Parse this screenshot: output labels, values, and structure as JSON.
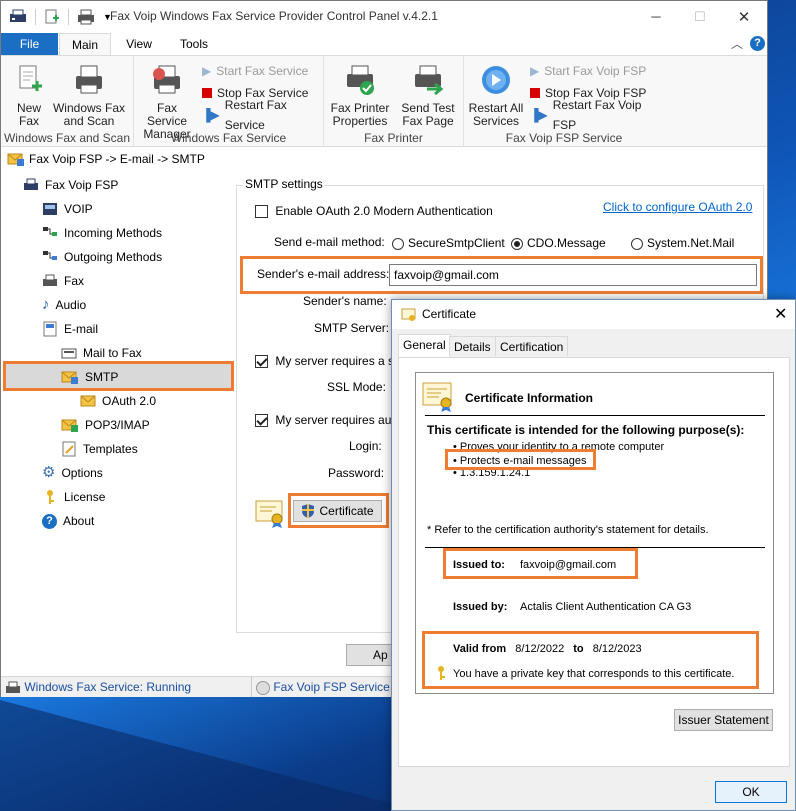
{
  "window": {
    "title": "Fax Voip Windows Fax Service Provider Control Panel v.4.2.1",
    "minimize": "─",
    "maximize": "☐",
    "close": "✕"
  },
  "ribbon_tabs": [
    "File",
    "Main",
    "View",
    "Tools"
  ],
  "ribbon_groups": {
    "g1": {
      "label": "Windows Fax and Scan",
      "new_fax": "New Fax",
      "wfs": "Windows Fax and Scan"
    },
    "g2": {
      "label": "Windows Fax Service",
      "manager": "Fax Service Manager",
      "start": "Start Fax Service",
      "stop": "Stop Fax Service",
      "restart": "Restart Fax Service"
    },
    "g3": {
      "label": "Fax Printer",
      "props": "Fax Printer Properties",
      "test": "Send Test Fax Page"
    },
    "g4": {
      "label": "Fax Voip FSP Service",
      "restart_all": "Restart All Services",
      "start": "Start Fax Voip FSP",
      "stop": "Stop Fax Voip FSP",
      "restart": "Restart Fax Voip FSP"
    }
  },
  "breadcrumb": "Fax Voip FSP -> E-mail -> SMTP",
  "tree": {
    "root": "Fax Voip FSP",
    "voip": "VOIP",
    "incoming": "Incoming Methods",
    "outgoing": "Outgoing Methods",
    "fax": "Fax",
    "audio": "Audio",
    "email": "E-mail",
    "mailtofax": "Mail to Fax",
    "smtp": "SMTP",
    "oauth": "OAuth 2.0",
    "pop3": "POP3/IMAP",
    "templates": "Templates",
    "options": "Options",
    "license": "License",
    "about": "About"
  },
  "smtp": {
    "group": "SMTP settings",
    "oauth_check": "Enable OAuth 2.0 Modern Authentication",
    "oauth_link": "Click to configure OAuth 2.0",
    "method_label": "Send e-mail method:",
    "methods": [
      "SecureSmtpClient",
      "CDO.Message",
      "System.Net.Mail"
    ],
    "sender_email_label": "Sender's e-mail address:",
    "sender_email": "faxvoip@gmail.com",
    "sender_name_label": "Sender's name:",
    "server_label": "SMTP Server:",
    "secure_check": "My server requires a se",
    "ssl_label": "SSL Mode:",
    "auth_check": "My server requires auth",
    "login_label": "Login:",
    "password_label": "Password:",
    "certificate_btn": "Certificate",
    "apply_btn": "Ap"
  },
  "status": {
    "left": "Windows Fax Service: Running",
    "right": "Fax Voip FSP Service: R"
  },
  "certificate": {
    "title": "Certificate",
    "tabs": [
      "General",
      "Details",
      "Certification Path"
    ],
    "info_title": "Certificate Information",
    "purpose_heading": "This certificate is intended for the following purpose(s):",
    "purposes": [
      "Proves your identity to a remote computer",
      "Protects e-mail messages",
      "1.3.159.1.24.1"
    ],
    "refer": "* Refer to the certification authority's statement for details.",
    "issued_to_label": "Issued to:",
    "issued_to": "faxvoip@gmail.com",
    "issued_by_label": "Issued by:",
    "issued_by": "Actalis Client Authentication CA G3",
    "valid_from_label": "Valid from",
    "valid_from": "8/12/2022",
    "to_label": "to",
    "valid_to": "8/12/2023",
    "private_key": "You have a private key that corresponds to this certificate.",
    "issuer_btn": "Issuer Statement",
    "ok_btn": "OK"
  },
  "colors": {
    "file_tab": "#1a6fc4",
    "highlight": "#ee7d31",
    "selected_row": "#d9d9d9",
    "link": "#0066cc"
  }
}
